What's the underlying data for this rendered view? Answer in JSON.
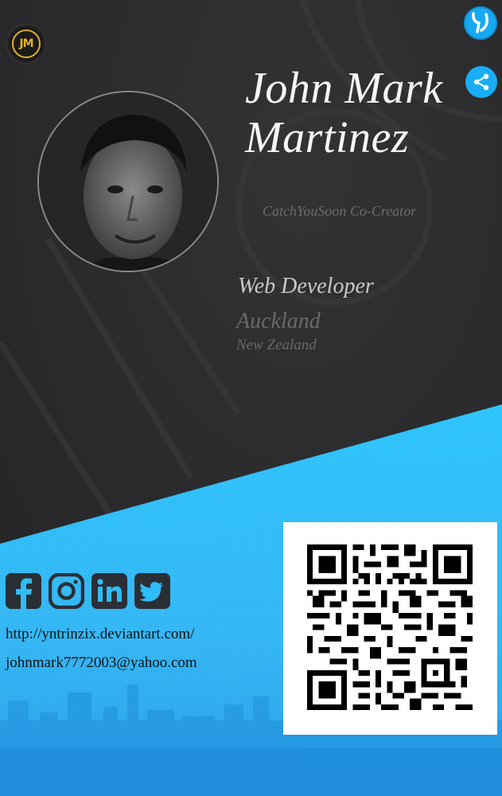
{
  "profile": {
    "first_name": "John Mark",
    "last_name": "Martinez",
    "tagline": "CatchYouSoon Co-Creator",
    "role": "Web Developer",
    "city": "Auckland",
    "country": "New Zealand"
  },
  "logo": {
    "text": "JM",
    "color": "#e2b12a"
  },
  "actions": {
    "brand_icon": "catchyousoon-logo-icon",
    "share_icon": "share-icon"
  },
  "socials": [
    {
      "name": "facebook-icon"
    },
    {
      "name": "instagram-icon"
    },
    {
      "name": "linkedin-icon"
    },
    {
      "name": "twitter-icon"
    }
  ],
  "links": {
    "website": "http://yntrinzix.deviantart.com/",
    "email": "johnmark7772003@yahoo.com"
  },
  "colors": {
    "dark_bg": "#2b2b2d",
    "accent_blue": "#2fbdf7",
    "icon_dark": "#2a2f36"
  }
}
